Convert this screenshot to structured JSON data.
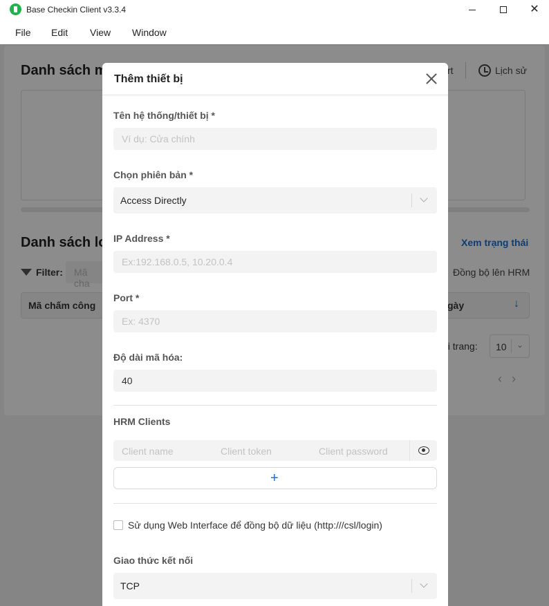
{
  "window": {
    "title": "Base Checkin Client v3.3.4"
  },
  "menu": [
    "File",
    "Edit",
    "View",
    "Window"
  ],
  "background": {
    "title1": "Danh sách m",
    "history": "Lịch sử",
    "rt": "rt",
    "title2": "Danh sách lo",
    "status_link": "Xem trạng thái",
    "filter_label": "Filter:",
    "filter_placeholder": "Mã cha",
    "sync_label": "Đồng bộ lên HRM",
    "col_code": "Mã chấm công",
    "col_date": "gày",
    "sort_arrow": "↓",
    "per_page_label": "ối trang:",
    "per_page_value": "10",
    "pagination": "‹›"
  },
  "modal": {
    "title": "Thêm thiết bị",
    "device_name": {
      "label": "Tên hệ thống/thiết bị *",
      "placeholder": "Ví dụ: Cửa chính",
      "value": ""
    },
    "version": {
      "label": "Chọn phiên bản *",
      "value": "Access Directly"
    },
    "ip": {
      "label": "IP Address *",
      "placeholder": "Ex:192.168.0.5, 10.20.0.4",
      "value": ""
    },
    "port": {
      "label": "Port *",
      "placeholder": "Ex: 4370",
      "value": ""
    },
    "encode_length": {
      "label": "Độ dài mã hóa:",
      "value": "40"
    },
    "hrm_clients": {
      "label": "HRM Clients",
      "name_placeholder": "Client name",
      "token_placeholder": "Client token",
      "password_placeholder": "Client password",
      "add_label": "+"
    },
    "web_interface": {
      "label": "Sử dụng Web Interface để đồng bộ dữ liệu (http:///csl/login)",
      "checked": false
    },
    "protocol": {
      "label": "Giao thức kết nối",
      "value": "TCP"
    }
  }
}
